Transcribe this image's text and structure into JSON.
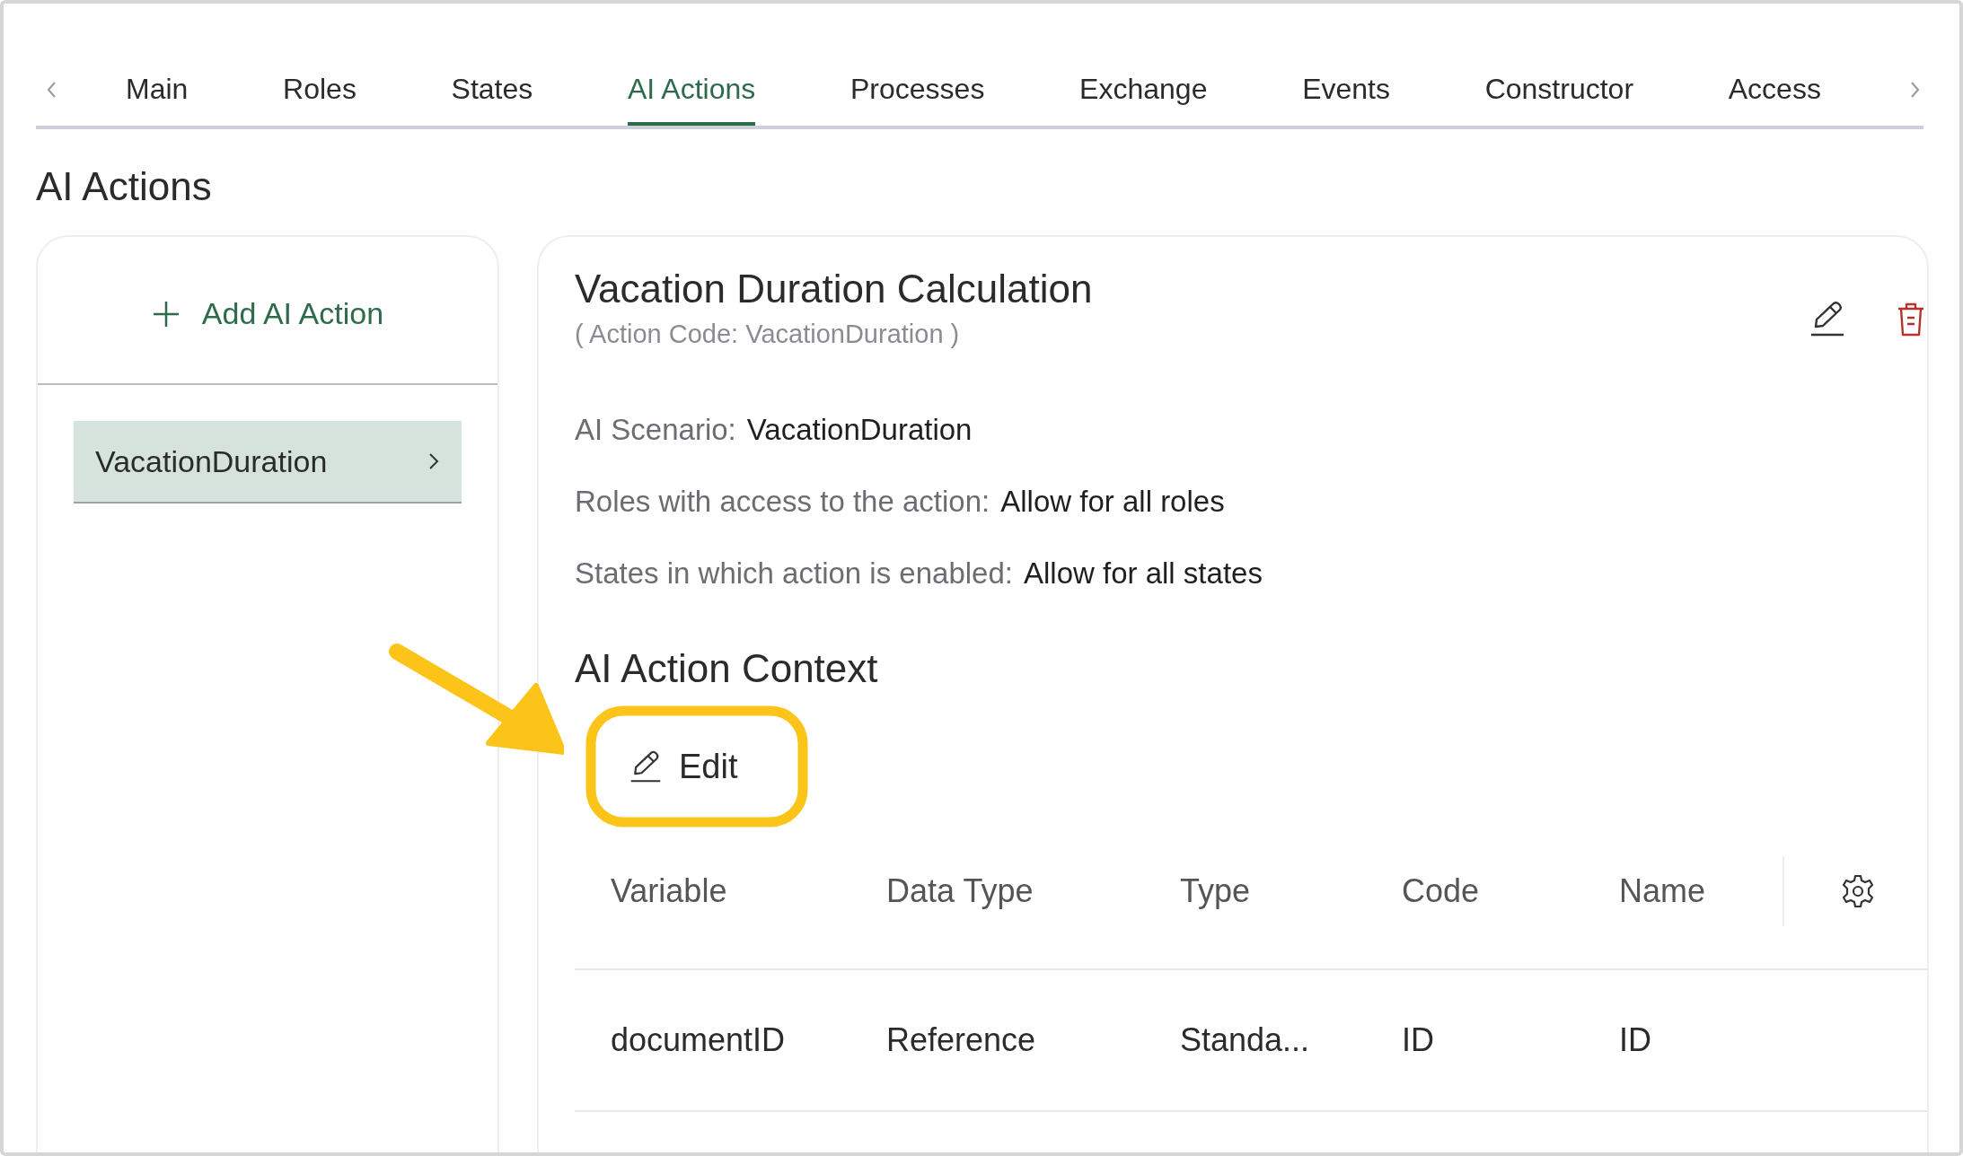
{
  "tabs": [
    {
      "label": "Main",
      "selected": false
    },
    {
      "label": "Roles",
      "selected": false
    },
    {
      "label": "States",
      "selected": false
    },
    {
      "label": "AI Actions",
      "selected": true
    },
    {
      "label": "Processes",
      "selected": false
    },
    {
      "label": "Exchange",
      "selected": false
    },
    {
      "label": "Events",
      "selected": false
    },
    {
      "label": "Constructor",
      "selected": false
    },
    {
      "label": "Access",
      "selected": false
    }
  ],
  "page_title": "AI Actions",
  "sidebar": {
    "add_button": "Add AI Action",
    "items": [
      {
        "label": "VacationDuration",
        "selected": true
      }
    ]
  },
  "detail": {
    "title": "Vacation Duration Calculation",
    "subtitle": "( Action Code: VacationDuration )",
    "fields": [
      {
        "label": "AI Scenario:",
        "value": "VacationDuration"
      },
      {
        "label": "Roles with access to the action:",
        "value": "Allow for all roles"
      },
      {
        "label": "States in which action is enabled:",
        "value": "Allow for all states"
      }
    ],
    "context_heading": "AI Action Context",
    "edit_button": "Edit",
    "table": {
      "columns": [
        "Variable",
        "Data Type",
        "Type",
        "Code",
        "Name"
      ],
      "rows": [
        [
          "documentID",
          "Reference",
          "Standa...",
          "ID",
          "ID"
        ]
      ]
    }
  }
}
